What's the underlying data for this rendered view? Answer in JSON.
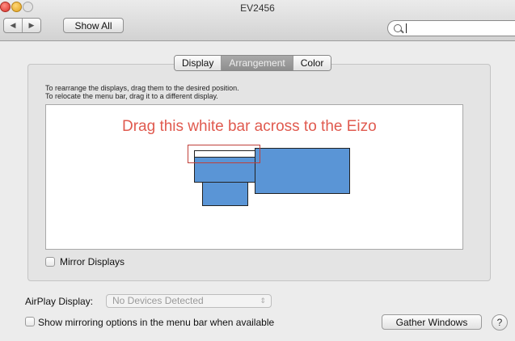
{
  "window": {
    "title": "EV2456"
  },
  "toolbar": {
    "back_icon": "◀",
    "forward_icon": "▶",
    "show_all_label": "Show All",
    "search_value": ""
  },
  "tabs": [
    {
      "label": "Display",
      "active": false
    },
    {
      "label": "Arrangement",
      "active": true
    },
    {
      "label": "Color",
      "active": false
    }
  ],
  "arrangement": {
    "instruction_1": "To rearrange the displays, drag them to the desired position.",
    "instruction_2": "To relocate the menu bar, drag it to a different display.",
    "hint_text": "Drag this white bar across to the Eizo",
    "colors": {
      "display": "#5a95d6",
      "hint": "#e05a4f",
      "highlight": "#c0403a"
    }
  },
  "mirror_displays": {
    "label": "Mirror Displays",
    "checked": false
  },
  "airplay": {
    "label": "AirPlay Display:",
    "selected": "No Devices Detected",
    "arrows": "⇕"
  },
  "mirroring_option": {
    "label": "Show mirroring options in the menu bar when available",
    "checked": false
  },
  "gather_windows_label": "Gather Windows",
  "help_label": "?"
}
